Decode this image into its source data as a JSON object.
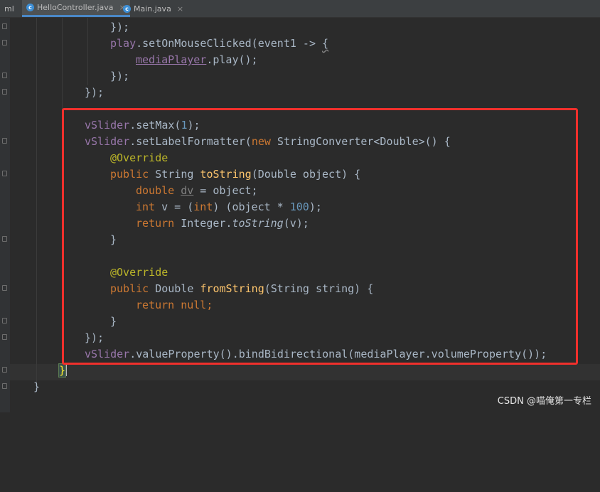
{
  "tabs": [
    {
      "label": "ml",
      "icon": "none",
      "active": false
    },
    {
      "label": "HelloController.java",
      "icon": "class-icon",
      "active": true
    },
    {
      "label": "Main.java",
      "icon": "class-icon",
      "active": false
    }
  ],
  "tab_close": "×",
  "code": {
    "l1_close": "});",
    "l2_obj": "play",
    "l2_method": ".setOnMouseClicked(event1 -> ",
    "l2_brace": "{",
    "l3_field": "mediaPlayer",
    "l3_call": ".play();",
    "l4": "});",
    "l5": "});",
    "l7_obj": "vSlider",
    "l7_call": ".setMax(",
    "l7_num": "1",
    "l7_end": ");",
    "l8_obj": "vSlider",
    "l8_call": ".setLabelFormatter(",
    "l8_new": "new",
    "l8_rest": " StringConverter<Double>() {",
    "l9_ann": "@Override",
    "l10_kw": "public",
    "l10_type": " String ",
    "l10_fn": "toString",
    "l10_rest": "(Double object) {",
    "l11_kw": "double",
    "l11_var": "dv",
    "l11_rest": " = object;",
    "l12_kw": "int",
    "l12_a": " v = (",
    "l12_kw2": "int",
    "l12_b": ") (object * ",
    "l12_num": "100",
    "l12_c": ");",
    "l13_kw": "return",
    "l13_a": " Integer.",
    "l13_fn": "toString",
    "l13_b": "(v);",
    "l14": "}",
    "l16_ann": "@Override",
    "l17_kw": "public",
    "l17_type": " Double ",
    "l17_fn": "fromString",
    "l17_rest": "(String string) {",
    "l18_kw": "return",
    "l18_null": " null",
    "l18_end": ";",
    "l19": "}",
    "l20": "});",
    "l21_obj": "vSlider",
    "l21_rest": ".valueProperty().bindBidirectional(mediaPlayer.volumeProperty());",
    "l22": "}",
    "l23": "}"
  },
  "watermark": "CSDN @喵俺第一专栏",
  "colors": {
    "keyword": "#cc7832",
    "method": "#ffc66d",
    "field": "#9876aa",
    "number": "#6897bb",
    "annotation": "#bbb529",
    "highlight_box": "#f0302c"
  }
}
